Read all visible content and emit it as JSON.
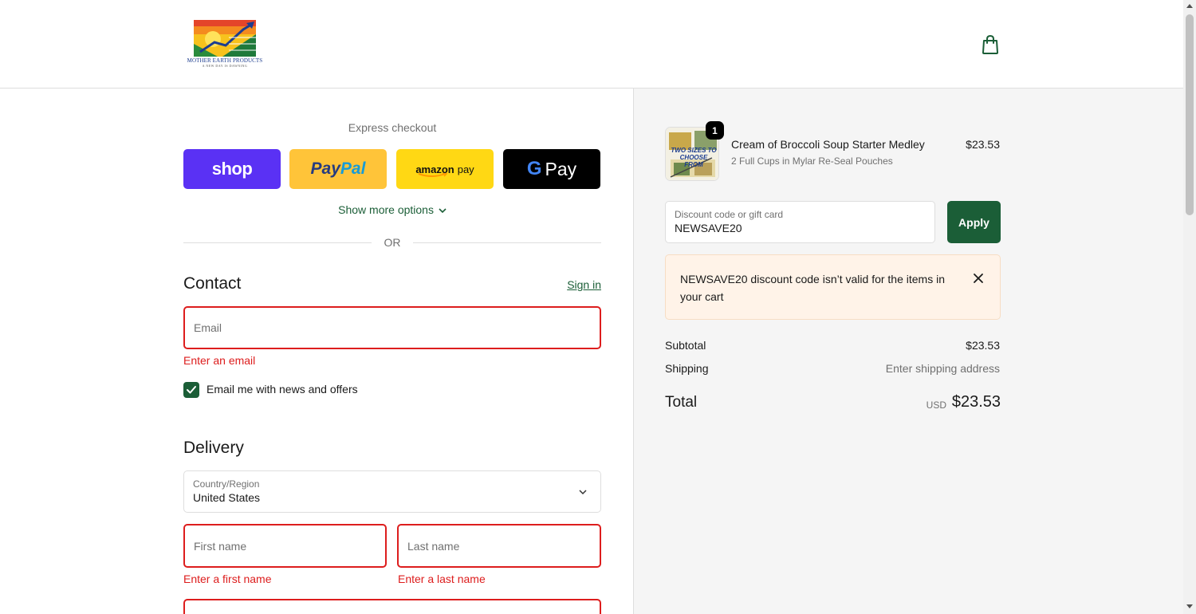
{
  "header": {
    "logo_text": "MOTHER EARTH PRODUCTS",
    "logo_subtext": "A NEW DAY IS DAWNING"
  },
  "express": {
    "title": "Express checkout",
    "shop_label": "shop",
    "paypal_part1": "Pay",
    "paypal_part2": "Pal",
    "amazon_label1": "amazon",
    "amazon_label2": "pay",
    "gpay_g": "G",
    "gpay_label": "Pay",
    "show_more": "Show more options",
    "or_text": "OR"
  },
  "contact": {
    "title": "Contact",
    "sign_in": "Sign in",
    "email_placeholder": "Email",
    "email_error": "Enter an email",
    "news_label": "Email me with news and offers",
    "news_checked": true
  },
  "delivery": {
    "title": "Delivery",
    "country_label": "Country/Region",
    "country_value": "United States",
    "first_name_placeholder": "First name",
    "first_name_error": "Enter a first name",
    "last_name_placeholder": "Last name",
    "last_name_error": "Enter a last name"
  },
  "order": {
    "item": {
      "name": "Cream of Broccoli Soup Starter Medley",
      "variant": "2 Full Cups in Mylar Re-Seal Pouches",
      "price": "$23.53",
      "quantity": "1",
      "thumb_text": "TWO SIZES TO CHOOSE FROM"
    },
    "discount_label": "Discount code or gift card",
    "discount_value": "NEWSAVE20",
    "apply_label": "Apply",
    "notice": "NEWSAVE20 discount code isn’t valid for the items in your cart",
    "subtotal_label": "Subtotal",
    "subtotal_value": "$23.53",
    "shipping_label": "Shipping",
    "shipping_value": "Enter shipping address",
    "total_label": "Total",
    "total_currency": "USD",
    "total_value": "$23.53"
  },
  "colors": {
    "accent": "#1b5e37",
    "error": "#dd1d1d",
    "shop_purple": "#5a31f4",
    "paypal_yellow": "#ffc439",
    "amazon_yellow": "#ffd814",
    "notice_bg": "#fff3e8"
  }
}
